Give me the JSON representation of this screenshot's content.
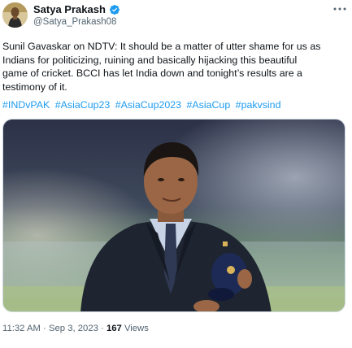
{
  "user": {
    "display_name": "Satya Prakash",
    "handle": "@Satya_Prakash08",
    "verified": true
  },
  "tweet": {
    "text_lines": [
      "Sunil Gavaskar on NDTV: It should be a matter of utter shame for us as",
      "Indians for politicizing, ruining and basically hijacking this beautiful",
      "game of cricket. BCCI has let India down and tonight’s results are a",
      "testimony of it."
    ],
    "hashtags": [
      "#INDvPAK",
      "#AsiaCup23",
      "#AsiaCup2023",
      "#AsiaCup",
      "#pakvsind"
    ]
  },
  "meta": {
    "time": "11:32 AM",
    "separator": "·",
    "date": "Sep 3, 2023",
    "views_count": "167",
    "views_label": "Views"
  },
  "icons": {
    "more": "more-horizontal-icon",
    "verified": "verified-badge-icon"
  },
  "colors": {
    "link": "#1d9bf0",
    "secondary_text": "#536471",
    "primary_text": "#0f1419"
  }
}
